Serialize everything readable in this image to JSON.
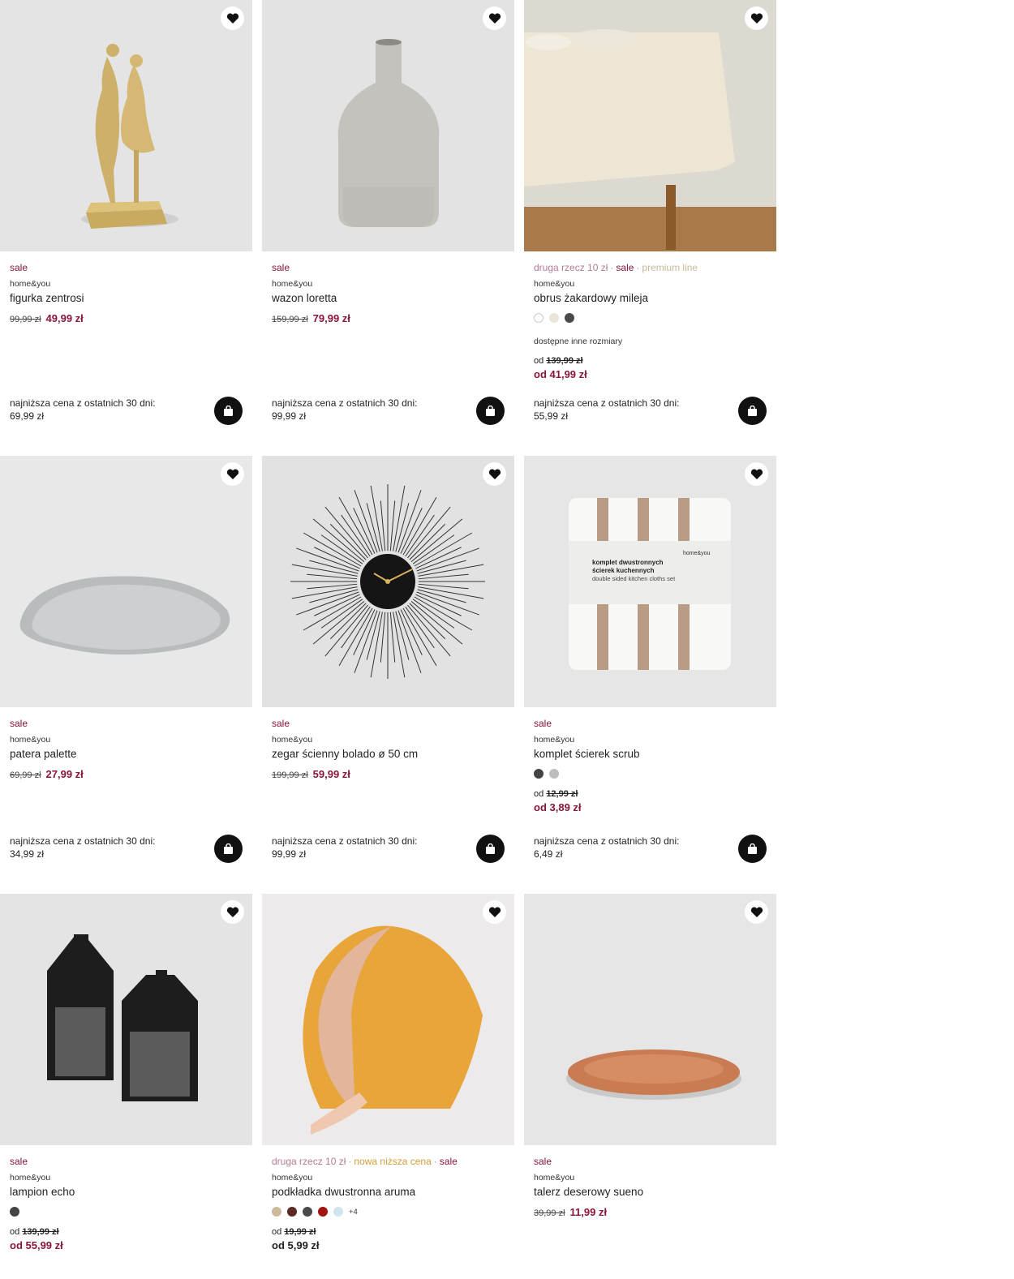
{
  "colors": {
    "sale": "#8a1538",
    "second": "#b57a94",
    "new_lower": "#d49c3c",
    "premium": "#c9b79a"
  },
  "products": [
    {
      "tags": [
        {
          "text": "sale",
          "kind": "sale"
        }
      ],
      "brand": "home&you",
      "name": "figurka zentrosi",
      "old_price": "99,99 zł",
      "price": "49,99 zł",
      "lowest_label": "najniższa cena z ostatnich 30 dni:",
      "lowest_value": "69,99 zł"
    },
    {
      "tags": [
        {
          "text": "sale",
          "kind": "sale"
        }
      ],
      "brand": "home&you",
      "name": "wazon loretta",
      "old_price": "159,99 zł",
      "price": "79,99 zł",
      "lowest_label": "najniższa cena z ostatnich 30 dni:",
      "lowest_value": "99,99 zł"
    },
    {
      "tags": [
        {
          "text": "druga rzecz 10 zł",
          "kind": "second"
        },
        {
          "text": "sale",
          "kind": "sale"
        },
        {
          "text": "premium line",
          "kind": "premium"
        }
      ],
      "brand": "home&you",
      "name": "obrus żakardowy mileja",
      "swatches": [
        "#ffffff",
        "#ece6da",
        "#4a4a4a"
      ],
      "available": "dostępne inne rozmiary",
      "from_prefix": "od",
      "from_old": "139,99 zł",
      "from_new": "od 41,99 zł",
      "lowest_label": "najniższa cena z ostatnich 30 dni:",
      "lowest_value": "55,99 zł"
    },
    {
      "tags": [
        {
          "text": "sale",
          "kind": "sale"
        }
      ],
      "brand": "home&you",
      "name": "patera palette",
      "old_price": "69,99 zł",
      "price": "27,99 zł",
      "lowest_label": "najniższa cena z ostatnich 30 dni:",
      "lowest_value": "34,99 zł"
    },
    {
      "tags": [
        {
          "text": "sale",
          "kind": "sale"
        }
      ],
      "brand": "home&you",
      "name": "zegar ścienny bolado ø 50 cm",
      "old_price": "199,99 zł",
      "price": "59,99 zł",
      "lowest_label": "najniższa cena z ostatnich 30 dni:",
      "lowest_value": "99,99 zł"
    },
    {
      "tags": [
        {
          "text": "sale",
          "kind": "sale"
        }
      ],
      "brand": "home&you",
      "name": "komplet ścierek scrub",
      "swatches": [
        "#444444",
        "#bdbdbd"
      ],
      "from_prefix": "od",
      "from_old": "12,99 zł",
      "from_new": "od 3,89 zł",
      "lowest_label": "najniższa cena z ostatnich 30 dni:",
      "lowest_value": "6,49 zł"
    },
    {
      "tags": [
        {
          "text": "sale",
          "kind": "sale"
        }
      ],
      "brand": "home&you",
      "name": "lampion echo",
      "swatches": [
        "#444444"
      ],
      "from_prefix": "od",
      "from_old": "139,99 zł",
      "from_new": "od 55,99 zł"
    },
    {
      "tags": [
        {
          "text": "druga rzecz 10 zł",
          "kind": "second"
        },
        {
          "text": "nowa niższa cena",
          "kind": "new_lower"
        },
        {
          "text": "sale",
          "kind": "sale"
        }
      ],
      "brand": "home&you",
      "name": "podkładka dwustronna aruma",
      "swatches": [
        "#cdb99c",
        "#5a2a24",
        "#4a4a4a",
        "#a51212",
        "#cfe6ee"
      ],
      "swatches_more": "+4",
      "from_prefix": "od",
      "from_old": "19,99 zł",
      "from_new": "od 5,99 zł",
      "from_dark": true
    },
    {
      "tags": [
        {
          "text": "sale",
          "kind": "sale"
        }
      ],
      "brand": "home&you",
      "name": "talerz deserowy sueno",
      "old_price": "39,99 zł",
      "price": "11,99 zł"
    }
  ],
  "package_text": {
    "brand": "home&you",
    "line1": "komplet dwustronnych",
    "line2": "ścierek kuchennych",
    "line3": "double sided kitchen cloths set"
  }
}
